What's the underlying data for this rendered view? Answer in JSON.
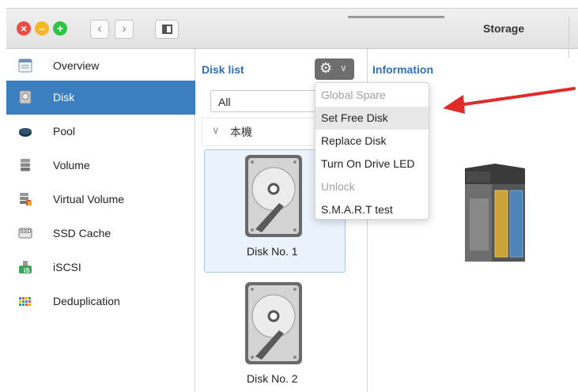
{
  "window": {
    "title": "Storage"
  },
  "toolbar": {
    "back_icon": "chevron-left",
    "forward_icon": "chevron-right",
    "panel_icon": "sidebar-toggle"
  },
  "sidebar": {
    "items": [
      {
        "label": "Overview",
        "icon": "overview-icon",
        "active": false
      },
      {
        "label": "Disk",
        "icon": "disk-icon",
        "active": true
      },
      {
        "label": "Pool",
        "icon": "pool-icon",
        "active": false
      },
      {
        "label": "Volume",
        "icon": "volume-icon",
        "active": false
      },
      {
        "label": "Virtual Volume",
        "icon": "virtual-volume-icon",
        "active": false
      },
      {
        "label": "SSD Cache",
        "icon": "ssd-icon",
        "active": false
      },
      {
        "label": "iSCSI",
        "icon": "iscsi-icon",
        "active": false
      },
      {
        "label": "Deduplication",
        "icon": "deduplication-icon",
        "active": false
      }
    ],
    "ssd_icon_text": "SSD",
    "iscsi_icon_text": "iS"
  },
  "disklist": {
    "title": "Disk list",
    "filter_value": "All",
    "group_label": "本機",
    "disks": [
      {
        "label": "Disk No. 1",
        "selected": true
      },
      {
        "label": "Disk No. 2",
        "selected": false
      }
    ]
  },
  "info": {
    "title": "Information"
  },
  "menu": {
    "items": [
      {
        "label": "Global Spare",
        "enabled": false
      },
      {
        "label": "Set Free Disk",
        "enabled": true,
        "highlighted": true
      },
      {
        "label": "Replace Disk",
        "enabled": true
      },
      {
        "label": "Turn On Drive LED",
        "enabled": true
      },
      {
        "label": "Unlock",
        "enabled": false
      },
      {
        "label": "S.M.A.R.T test",
        "enabled": true
      }
    ]
  },
  "colors": {
    "accent": "#3c7fc0",
    "title_blue": "#2f6fb3",
    "arrow": "#e02b2b"
  }
}
